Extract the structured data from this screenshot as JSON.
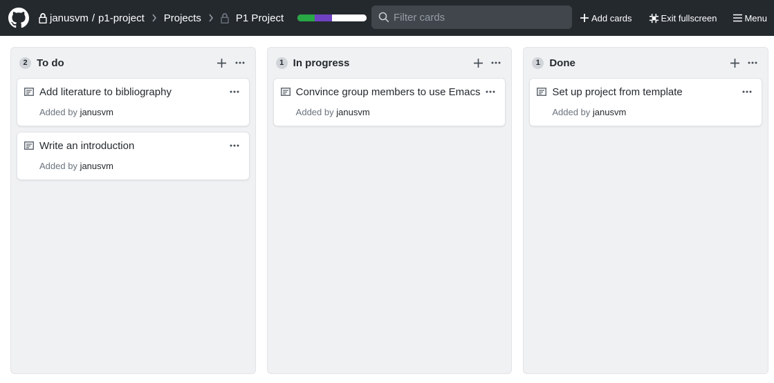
{
  "header": {
    "owner": "janusvm",
    "separator": "/",
    "repo": "p1-project",
    "projects_label": "Projects",
    "project_name": "P1 Project",
    "progress": {
      "done": 0.25,
      "in_progress": 0.25,
      "todo": 0.5
    },
    "colors": {
      "done": "#28a745",
      "in_progress": "#6f42c1",
      "todo": "#ffffff"
    }
  },
  "search": {
    "placeholder": "Filter cards"
  },
  "actions": {
    "add_cards": "Add cards",
    "exit_fullscreen": "Exit fullscreen",
    "menu": "Menu"
  },
  "columns": [
    {
      "title": "To do",
      "count": "2",
      "cards": [
        {
          "title": "Add literature to bibliography",
          "added_by": "Added by",
          "author": "janusvm"
        },
        {
          "title": "Write an introduction",
          "added_by": "Added by",
          "author": "janusvm"
        }
      ]
    },
    {
      "title": "In progress",
      "count": "1",
      "cards": [
        {
          "title": "Convince group members to use Emacs",
          "added_by": "Added by",
          "author": "janusvm"
        }
      ]
    },
    {
      "title": "Done",
      "count": "1",
      "cards": [
        {
          "title": "Set up project from template",
          "added_by": "Added by",
          "author": "janusvm"
        }
      ]
    }
  ]
}
